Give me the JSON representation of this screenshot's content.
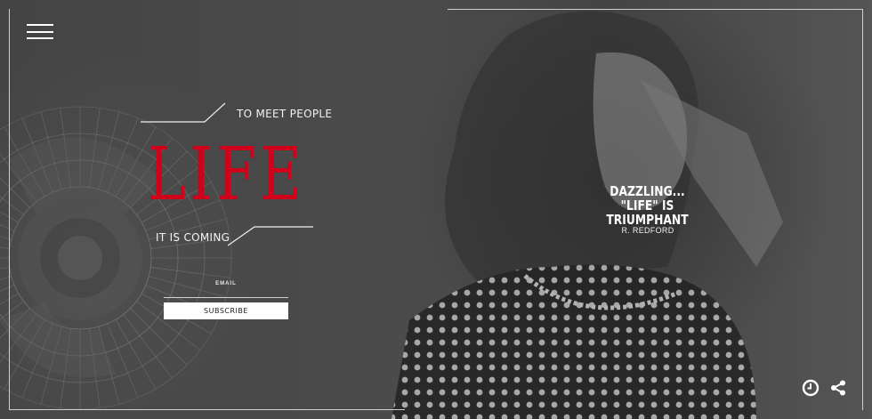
{
  "menu": {
    "icon": "hamburger-menu-icon"
  },
  "hero": {
    "tagline_top": "TO MEET PEOPLE",
    "logo": "LIFE",
    "tagline_bottom": "IT IS COMING",
    "accent_color": "#d0021b"
  },
  "newsletter": {
    "email_label": "EMAIL",
    "email_value": "",
    "subscribe_label": "SUBSCRIBE"
  },
  "quote": {
    "line1": "DAZZLING...",
    "line2": "\"LIFE\" IS TRIUMPHANT",
    "author": "R. REDFORD"
  },
  "footer": {
    "clock_icon": "clock-icon",
    "share_icon": "share-icon"
  }
}
